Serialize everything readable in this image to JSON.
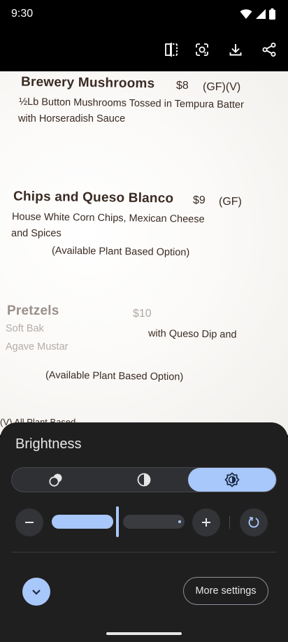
{
  "status_bar": {
    "time": "9:30"
  },
  "toolbar": {
    "icons": [
      "compare-icon",
      "lens-icon",
      "download-icon",
      "share-icon"
    ]
  },
  "menu_photo": {
    "items": [
      {
        "name": "Brewery Mushrooms",
        "price": "$8",
        "tags": "(GF)(V)",
        "desc_line1": "½Lb Button Mushrooms Tossed in Tempura Batter",
        "desc_line2": "with Horseradish Sauce"
      },
      {
        "name": "Chips and Queso Blanco",
        "price": "$9",
        "tags": "(GF)",
        "desc_line1": "House White Corn Chips, Mexican Cheese",
        "desc_line2": "and Spices",
        "note": "(Available Plant Based Option)"
      },
      {
        "name": "Pretzels",
        "price": "$10",
        "desc_line1_left": "Soft Bak",
        "desc_line1_right": "with Queso Dip and",
        "desc_line2": "Agave Mustar",
        "note": "(Available Plant Based Option)"
      }
    ],
    "footer_partial": "(V) All Plant Based"
  },
  "brightness_panel": {
    "title": "Brightness",
    "modes": [
      "auto-adjust-icon",
      "contrast-icon",
      "brightness-icon"
    ],
    "active_mode_index": 2,
    "slider": {
      "value": 0.5,
      "minus_icon": "minus-icon",
      "plus_icon": "plus-icon",
      "reset_icon": "reset-icon"
    },
    "collapse_icon": "chevron-down-icon",
    "more_settings_label": "More settings"
  },
  "colors": {
    "accent": "#a8c7fa",
    "panel_bg": "#1f1f1f",
    "menu_ink": "#3a2a22"
  }
}
